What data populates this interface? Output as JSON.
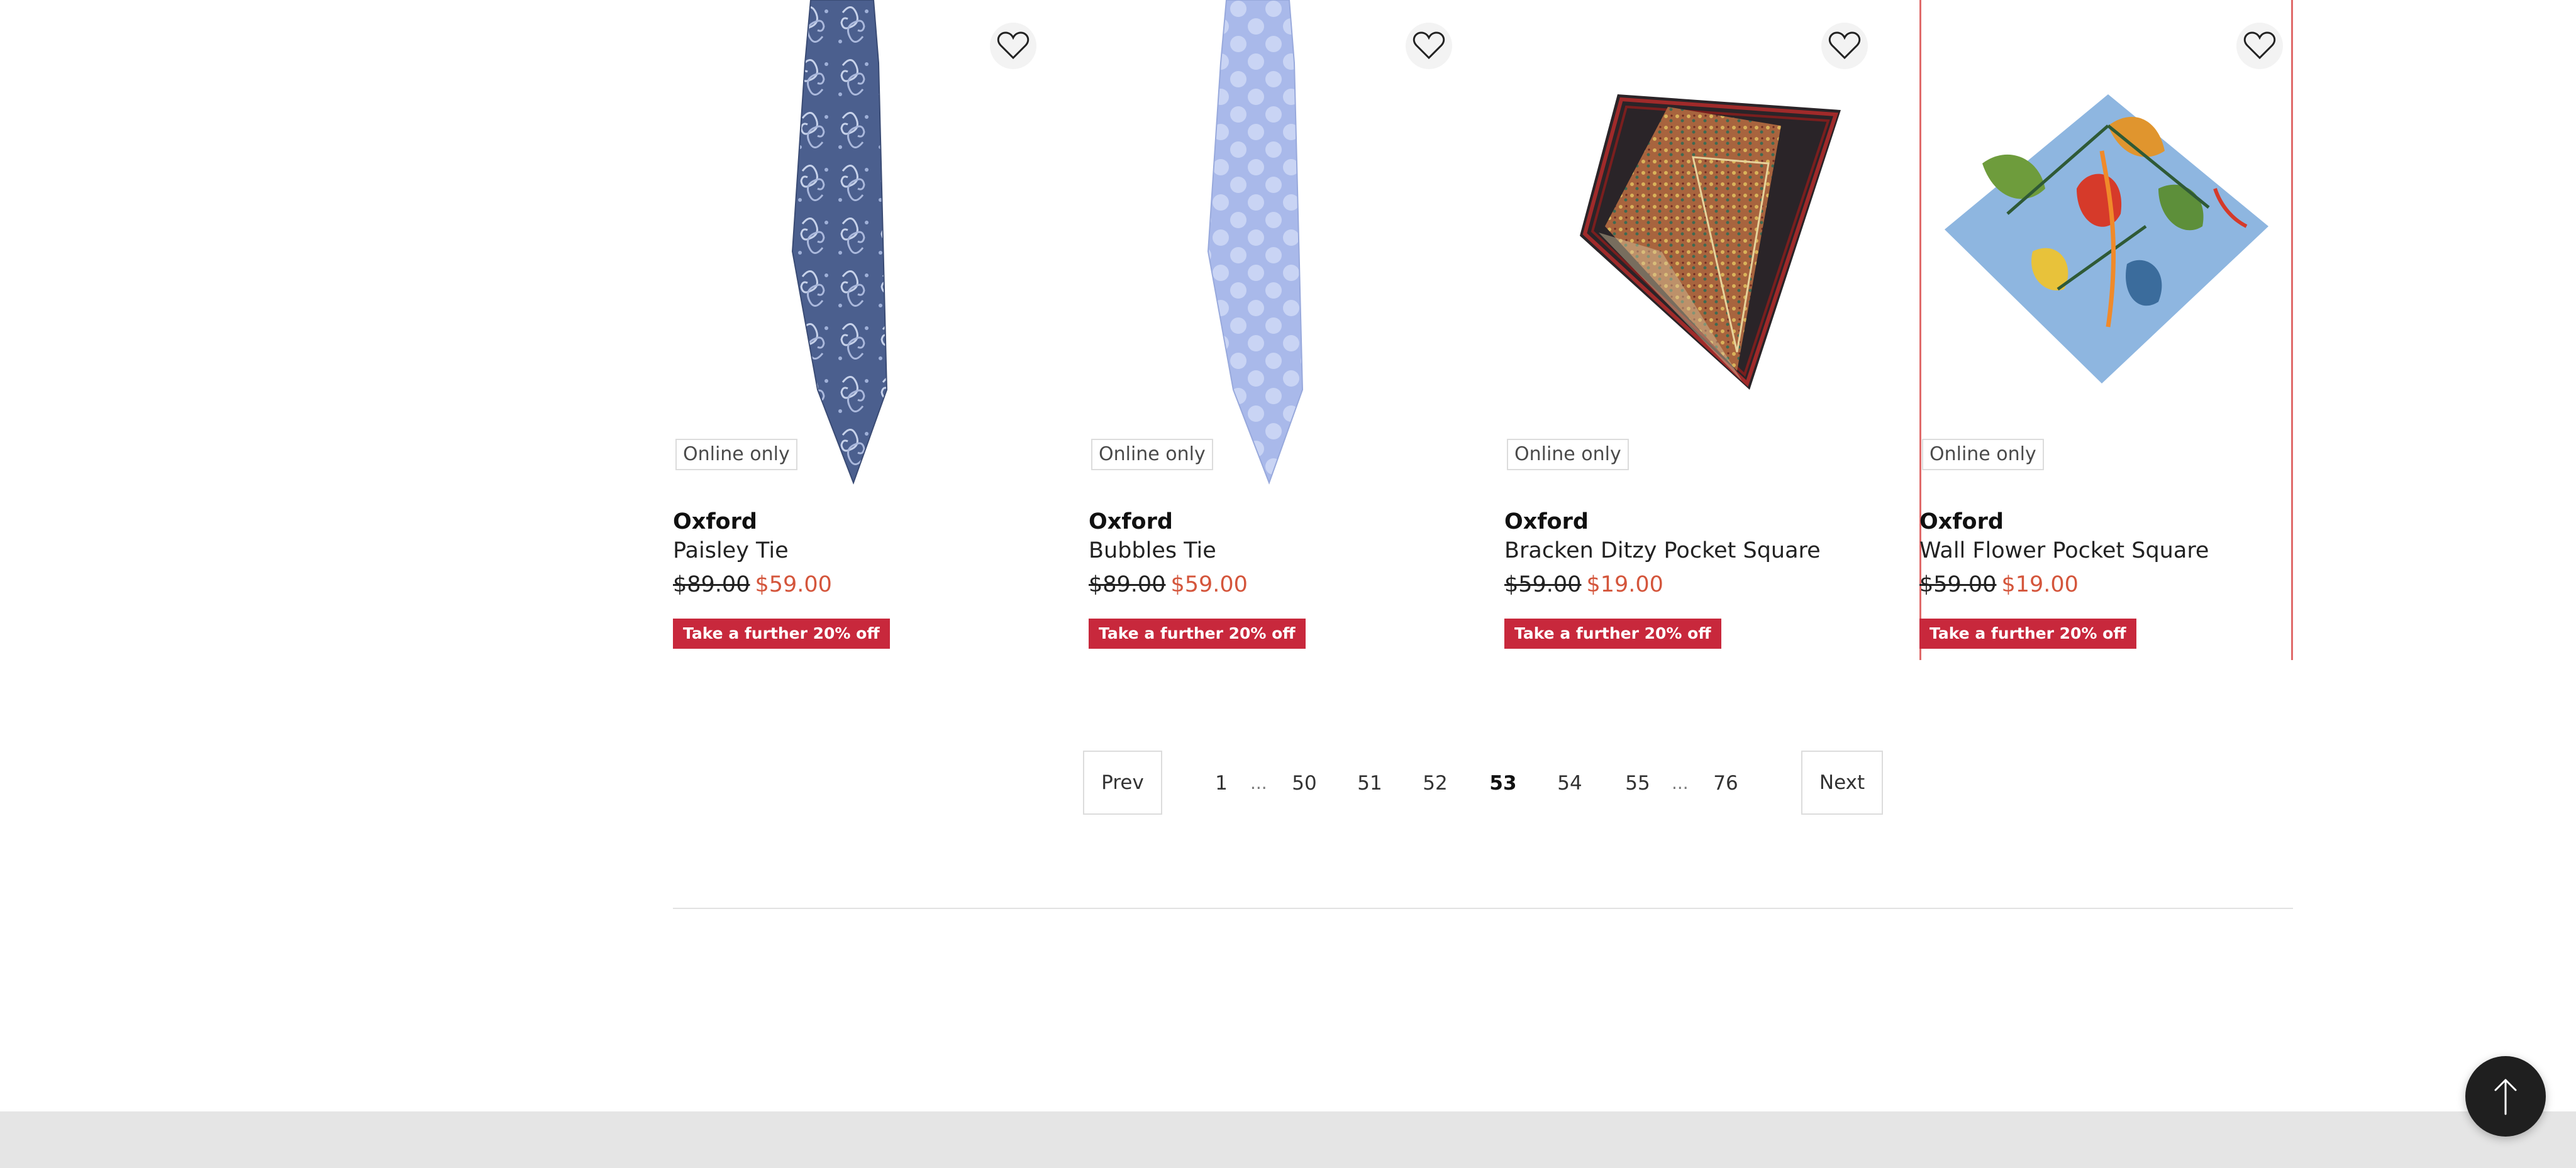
{
  "products": [
    {
      "badge": "Online only",
      "brand": "Oxford",
      "title": "Paisley Tie",
      "was_price": "$89.00",
      "now_price": "$59.00",
      "promo": "Take a further 20% off",
      "image": "paisley-tie-image",
      "wishlist_icon": "heart-icon"
    },
    {
      "badge": "Online only",
      "brand": "Oxford",
      "title": "Bubbles Tie",
      "was_price": "$89.00",
      "now_price": "$59.00",
      "promo": "Take a further 20% off",
      "image": "bubbles-tie-image",
      "wishlist_icon": "heart-icon"
    },
    {
      "badge": "Online only",
      "brand": "Oxford",
      "title": "Bracken Ditzy Pocket Square",
      "was_price": "$59.00",
      "now_price": "$19.00",
      "promo": "Take a further 20% off",
      "image": "pocket-square-image",
      "wishlist_icon": "heart-icon"
    },
    {
      "badge": "Online only",
      "brand": "Oxford",
      "title": "Wall Flower Pocket Square",
      "was_price": "$59.00",
      "now_price": "$19.00",
      "promo": "Take a further 20% off",
      "image": "floral-pocket-square-image",
      "wishlist_icon": "heart-icon"
    }
  ],
  "pagination": {
    "prev_label": "Prev",
    "next_label": "Next",
    "pages": [
      "1",
      "50",
      "51",
      "52",
      "53",
      "54",
      "55",
      "76"
    ],
    "current": "53",
    "ellipsis": "..."
  },
  "back_to_top_icon": "arrow-up-icon",
  "colors": {
    "sale_price": "#d4553b",
    "promo_bg": "#c8283c",
    "selected_outline": "#e06a6a",
    "footer_bg": "#e5e5e5"
  }
}
